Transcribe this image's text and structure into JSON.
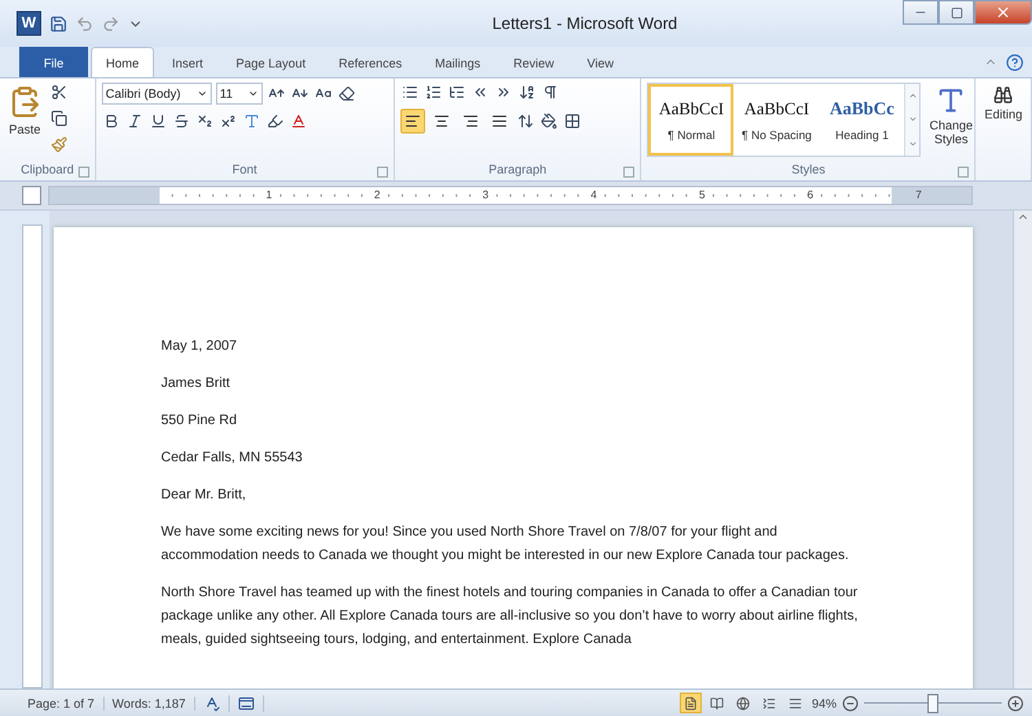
{
  "window": {
    "title": "Letters1 - Microsoft Word",
    "app_logo": "W"
  },
  "tabs": [
    {
      "label": "File",
      "kind": "file",
      "selected": false
    },
    {
      "label": "Home",
      "kind": "tab",
      "selected": true
    },
    {
      "label": "Insert",
      "kind": "tab",
      "selected": false
    },
    {
      "label": "Page Layout",
      "kind": "tab",
      "selected": false
    },
    {
      "label": "References",
      "kind": "tab",
      "selected": false
    },
    {
      "label": "Mailings",
      "kind": "tab",
      "selected": false
    },
    {
      "label": "Review",
      "kind": "tab",
      "selected": false
    },
    {
      "label": "View",
      "kind": "tab",
      "selected": false
    }
  ],
  "ribbon": {
    "clipboard": {
      "label": "Clipboard",
      "paste": "Paste"
    },
    "font": {
      "label": "Font",
      "font_name": "Calibri (Body)",
      "font_size": "11"
    },
    "paragraph": {
      "label": "Paragraph",
      "alignments": [
        {
          "kind": "left",
          "selected": true
        },
        {
          "kind": "center",
          "selected": false
        },
        {
          "kind": "right",
          "selected": false
        },
        {
          "kind": "justify",
          "selected": false
        }
      ]
    },
    "styles": {
      "label": "Styles",
      "items": [
        {
          "preview": "AaBbCcI",
          "name": "¶ Normal",
          "kind": "body",
          "selected": true
        },
        {
          "preview": "AaBbCcI",
          "name": "¶ No Spacing",
          "kind": "body",
          "selected": false
        },
        {
          "preview": "AaBbCc",
          "name": "Heading 1",
          "kind": "heading",
          "selected": false
        }
      ],
      "change_styles": "Change Styles"
    },
    "editing": {
      "label": "Editing"
    }
  },
  "ruler": {
    "numbers": [
      "1",
      "2",
      "3",
      "4",
      "5",
      "6",
      "7"
    ]
  },
  "document": {
    "paragraphs": [
      "May 1, 2007",
      "James Britt",
      "550 Pine Rd",
      "Cedar Falls, MN 55543",
      "Dear Mr. Britt,",
      "We have some exciting news for you! Since you used North Shore Travel on 7/8/07 for your flight and accommodation needs to Canada we thought you might be interested in our new Explore Canada tour packages.",
      "North Shore Travel has teamed up with the finest hotels and touring companies in Canada to offer a Canadian tour package unlike any other. All Explore Canada tours are all-inclusive so you don’t have to worry about airline flights, meals, guided sightseeing tours, lodging, and entertainment. Explore Canada"
    ]
  },
  "status_bar": {
    "page": "Page: 1 of 7",
    "words": "Words: 1,187",
    "views": [
      {
        "kind": "print",
        "selected": true
      },
      {
        "kind": "reading",
        "selected": false
      },
      {
        "kind": "web",
        "selected": false
      },
      {
        "kind": "outline",
        "selected": false
      },
      {
        "kind": "draft",
        "selected": false
      }
    ],
    "zoom": "94%",
    "zoom_slider": {
      "level": 0.5
    }
  }
}
